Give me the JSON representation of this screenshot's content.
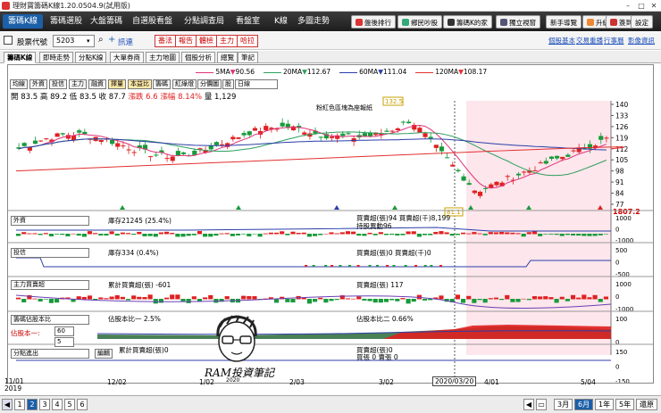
{
  "window": {
    "title": "理財寶籌碼K線1.20.0504.9(試用版)"
  },
  "menu": {
    "items": [
      "籌碼K線",
      "籌碼選股",
      "大盤籌碼",
      "自選股看盤",
      "分點調查局",
      "看盤室",
      "K線",
      "多圖走勢"
    ],
    "active": 0,
    "buttons": [
      "盤後排行",
      "鄉民吵股",
      "籌碼K的家",
      "獨立視窗",
      "新手導覽",
      "升級",
      "簽到",
      "設定"
    ]
  },
  "toolbar": {
    "stock_label": "股票代號",
    "stock_value": "5203",
    "stock_name": "訊連",
    "red_buttons": [
      "番法",
      "報告",
      "體檢",
      "主力",
      "哈拉"
    ],
    "links": [
      "個股基本",
      "交易重播",
      "行事曆",
      "影像資訊"
    ]
  },
  "tabs": {
    "items": [
      "籌碼K線",
      "即時走勢",
      "分點K線",
      "大單券商",
      "主力地圖",
      "個股分析",
      "總覽",
      "筆記"
    ],
    "active": 0
  },
  "ma_legend": [
    {
      "label": "5MA",
      "value": "90.56",
      "color": "#e0337a",
      "arrow": "down"
    },
    {
      "label": "20MA",
      "value": "112.67",
      "color": "#2e9e5e",
      "arrow": "down"
    },
    {
      "label": "60MA",
      "value": "111.04",
      "color": "#2c3ea8",
      "arrow": "down"
    },
    {
      "label": "120MA",
      "value": "108.17",
      "color": "#e23030",
      "arrow": "down"
    }
  ],
  "indicator_buttons": [
    "均線",
    "外資",
    "投信",
    "主力",
    "融資",
    "擇量",
    "本益比",
    "籌碼",
    "紅綠燈",
    "分價圖",
    "股"
  ],
  "period_select": "日線",
  "ohlc": {
    "open_label": "開",
    "open": "83.5",
    "high_label": "高",
    "high": "89.2",
    "low_label": "低",
    "low": "83.5",
    "close_label": "收",
    "close": "87.7",
    "change_label": "漲跌",
    "change": "6.6",
    "pct_label": "漲幅",
    "pct": "8.14%",
    "vol_label": "量",
    "vol": "1,129"
  },
  "zone_note": "粉紅色區塊為座報紙",
  "price_axis": [
    "140",
    "133",
    "126",
    "119",
    "112",
    "105",
    "98",
    "91",
    "84",
    "77"
  ],
  "price_annotations": {
    "high": "132.5",
    "low": "81.1",
    "right_value": "1807.2"
  },
  "panels": {
    "foreign": {
      "select": "外資",
      "text1": "庫存21245 (25.4%)",
      "text2": "買賣超(張)94 買賣超(千)8,199",
      "text3": "持股異動96",
      "axis": [
        "1000",
        "0",
        "-1000"
      ]
    },
    "trust": {
      "select": "投信",
      "text1": "庫存334 (0.4%)",
      "text2": "買賣超(張)0 買賣超(千)0",
      "axis": [
        "500",
        "0",
        "-500"
      ]
    },
    "main": {
      "select": "主力買賣超",
      "text1": "累計買賣超(張) -601",
      "text2": "買賣超(張) 117",
      "axis": [
        "1000",
        "0",
        "-1000"
      ]
    },
    "ratio": {
      "select": "籌碼佔股本比",
      "text1": "佔股本比一 2.5%",
      "text2": "佔股本比二 0.66%",
      "param1_label": "佔股本一:",
      "param1_value": "60",
      "param2_label": "",
      "param2_value": "5",
      "axis": [
        "100",
        "0"
      ]
    },
    "branch": {
      "select": "分點進出",
      "edit_btn": "編輯",
      "text1": "累計買賣超(張)0",
      "text2": "買賣超(張)0",
      "text3": "買張 0 賣張 0",
      "axis": [
        "150",
        "0",
        "-150"
      ]
    }
  },
  "x_axis": {
    "labels": [
      "11/01\n2019",
      "12/02",
      "1/02",
      "2/03",
      "3/02",
      "4/01",
      "5/04"
    ],
    "cursor_label": "2020/03/20"
  },
  "watermark": {
    "main": "RAM投資筆記",
    "sub": "2020"
  },
  "bottom": {
    "pages": [
      "1",
      "2",
      "3",
      "4",
      "5",
      "6"
    ],
    "active_page": 1,
    "ranges": [
      "3月",
      "6月",
      "1年",
      "5年",
      "還原"
    ],
    "active_range": 1
  },
  "colors": {
    "up": "#e02020",
    "down": "#179a3a",
    "accent": "#1b5fa8",
    "pink_zone": "#fde6ec"
  }
}
